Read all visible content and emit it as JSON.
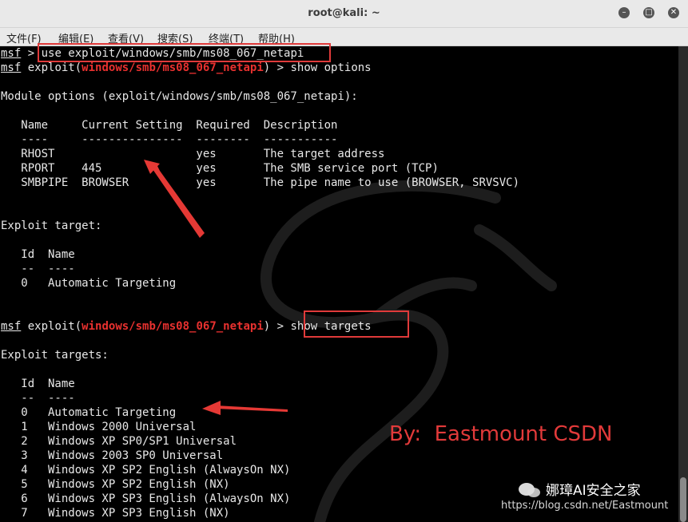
{
  "window": {
    "title": "root@kali: ~"
  },
  "menu": [
    "文件(F)",
    "编辑(E)",
    "查看(V)",
    "搜索(S)",
    "终端(T)",
    "帮助(H)"
  ],
  "terminal": {
    "prompt": "msf",
    "cmd1": "use exploit/windows/smb/ms08_067_netapi",
    "exploit_word": "exploit(",
    "module": "windows/smb/ms08_067_netapi",
    "prompt_tail": ") > ",
    "cmd2": "show options",
    "module_options_header": "Module options (exploit/windows/smb/ms08_067_netapi):",
    "options_header": "   Name     Current Setting  Required  Description",
    "options_sep": "   ----     ---------------  --------  -----------",
    "options_rows": [
      "   RHOST                     yes       The target address",
      "   RPORT    445              yes       The SMB service port (TCP)",
      "   SMBPIPE  BROWSER          yes       The pipe name to use (BROWSER, SRVSVC)"
    ],
    "exploit_target_header": "Exploit target:",
    "target_header": "   Id  Name",
    "target_sep": "   --  ----",
    "target_row": "   0   Automatic Targeting",
    "cmd3": "show targets",
    "exploit_targets_header": "Exploit targets:",
    "targets_header": "   Id  Name",
    "targets_sep": "   --  ----",
    "targets_rows": [
      "   0   Automatic Targeting",
      "   1   Windows 2000 Universal",
      "   2   Windows XP SP0/SP1 Universal",
      "   3   Windows 2003 SP0 Universal",
      "   4   Windows XP SP2 English (AlwaysOn NX)",
      "   5   Windows XP SP2 English (NX)",
      "   6   Windows XP SP3 English (AlwaysOn NX)",
      "   7   Windows XP SP3 English (NX)"
    ]
  },
  "annotation": {
    "byline": "By:  Eastmount CSDN"
  },
  "watermark": {
    "name": "娜璋AI安全之家",
    "url": "https://blog.csdn.net/Eastmount"
  },
  "colors": {
    "terminal_bg": "#000000",
    "text": "#e8e8e8",
    "module_red": "#e8312f",
    "annotation_red": "#e03a3a"
  }
}
